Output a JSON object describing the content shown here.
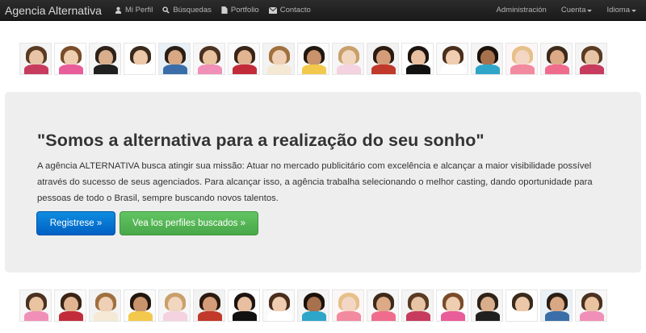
{
  "navbar": {
    "brand": "Agencia Alternativa",
    "left_items": [
      {
        "label": "Mi Perfil",
        "icon": "user-icon"
      },
      {
        "label": "Búsquedas",
        "icon": "search-icon"
      },
      {
        "label": "Portfolio",
        "icon": "file-icon"
      },
      {
        "label": "Contacto",
        "icon": "envelope-icon"
      }
    ],
    "right_items": [
      {
        "label": "Administración"
      },
      {
        "label": "Cuenta"
      },
      {
        "label": "Idioma"
      }
    ]
  },
  "hero": {
    "title": "\"Somos a alternativa para a realização do seu sonho\"",
    "text": "A agência ALTERNATIVA busca atingir sua missão: Atuar no mercado publicitário com excelência e alcançar a maior visibilidade possível através do sucesso de seus agenciados. Para alcançar isso, a agência trabalha selecionando o melhor casting, dando oportunidade para pessoas de todo o Brasil, sempre buscando novos talentos.",
    "register_button": "Registrese »",
    "profiles_button": "Vea los perfiles buscados »"
  },
  "colors": {
    "navbar": "#1b1b1b",
    "hero_bg": "#eeeeee",
    "primary": "#0074cc",
    "success": "#51a351"
  }
}
